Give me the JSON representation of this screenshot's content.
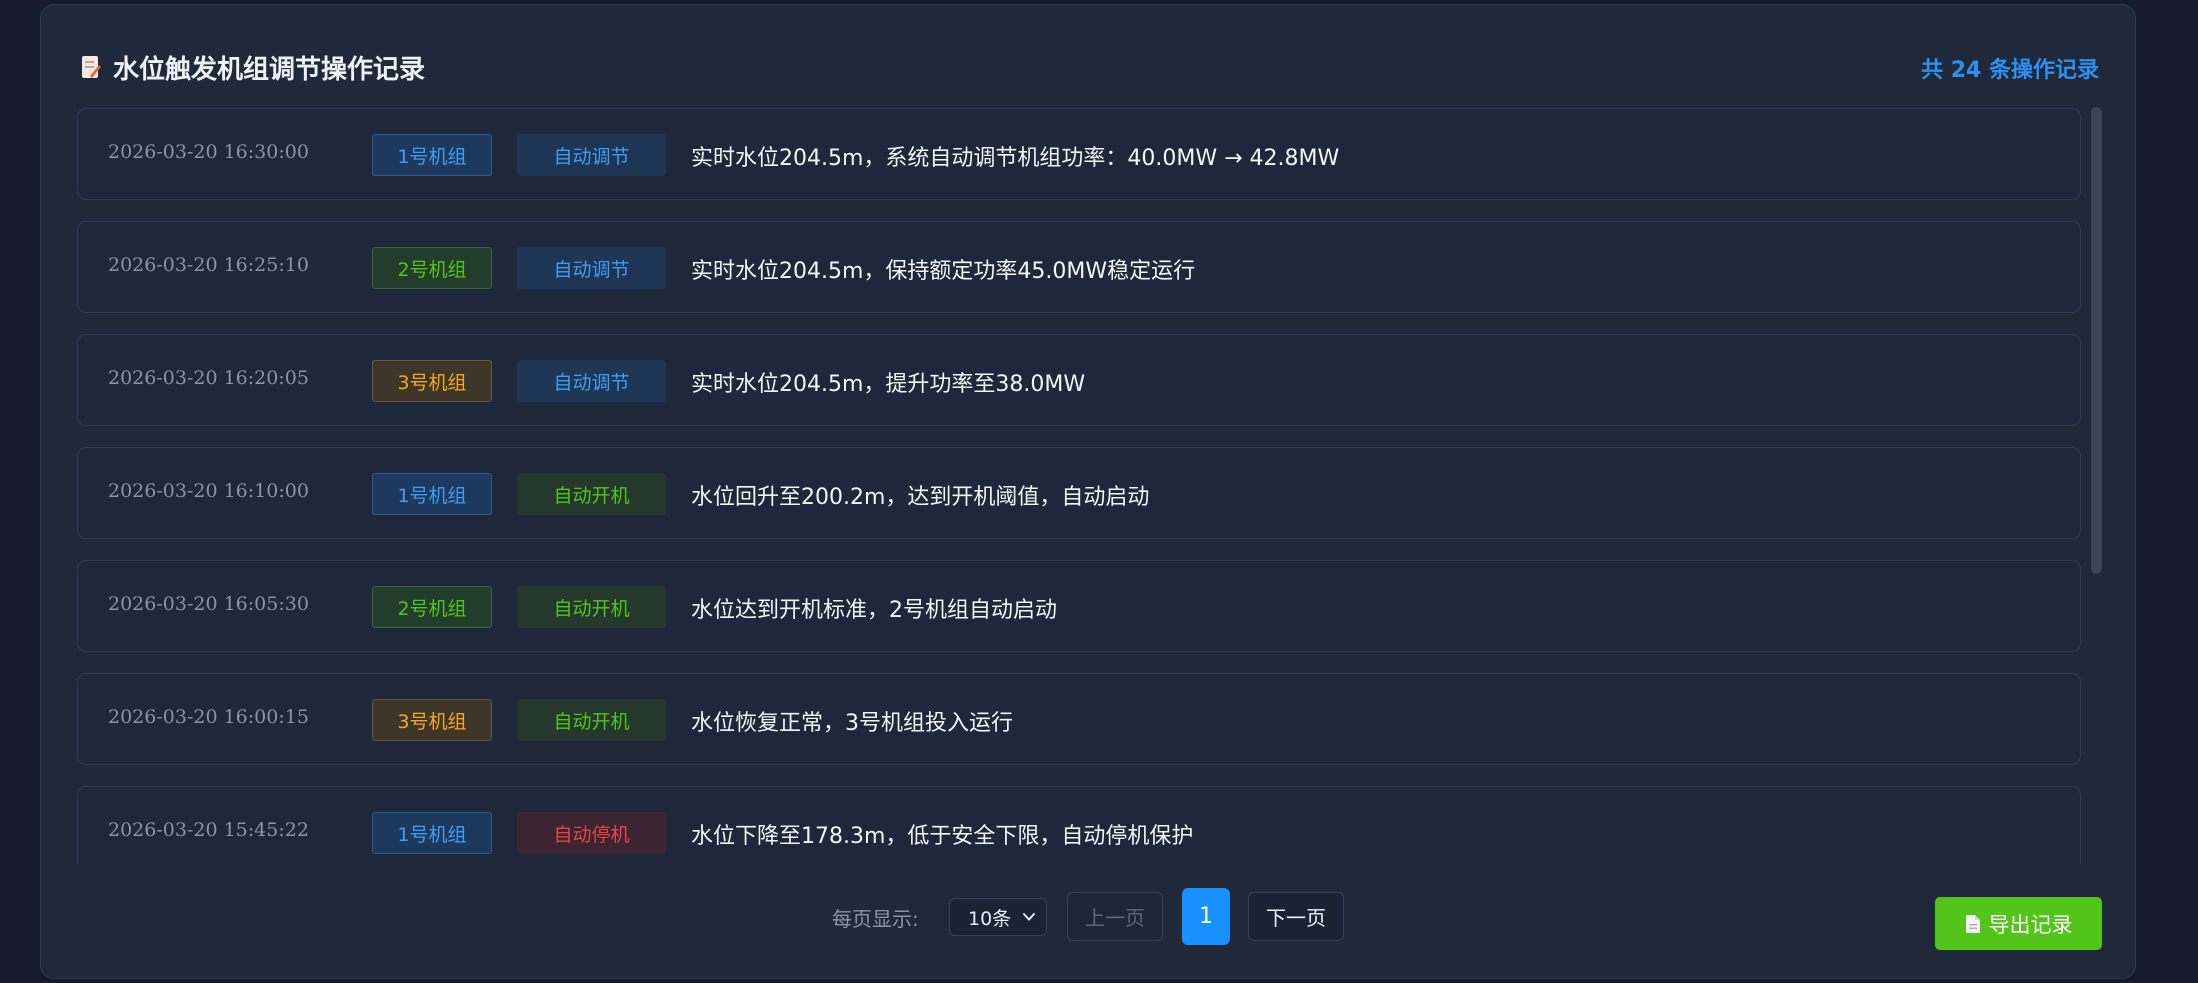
{
  "header": {
    "title": "水位触发机组调节操作记录",
    "title_icon": "memo-icon",
    "count_label": "共 24 条操作记录"
  },
  "colors": {
    "accent_blue": "#1890ff",
    "unit1": "#3f9cf2",
    "unit2": "#52c41a",
    "unit3": "#f5a623",
    "stop_red": "#e64545",
    "export_green": "#52c41a"
  },
  "records": [
    {
      "time": "2026-03-20 16:30:00",
      "unit": "1号机组",
      "action": "自动调节",
      "message": "实时水位204.5m，系统自动调节机组功率：40.0MW → 42.8MW"
    },
    {
      "time": "2026-03-20 16:25:10",
      "unit": "2号机组",
      "action": "自动调节",
      "message": "实时水位204.5m，保持额定功率45.0MW稳定运行"
    },
    {
      "time": "2026-03-20 16:20:05",
      "unit": "3号机组",
      "action": "自动调节",
      "message": "实时水位204.5m，提升功率至38.0MW"
    },
    {
      "time": "2026-03-20 16:10:00",
      "unit": "1号机组",
      "action": "自动开机",
      "message": "水位回升至200.2m，达到开机阈值，自动启动"
    },
    {
      "time": "2026-03-20 16:05:30",
      "unit": "2号机组",
      "action": "自动开机",
      "message": "水位达到开机标准，2号机组自动启动"
    },
    {
      "time": "2026-03-20 16:00:15",
      "unit": "3号机组",
      "action": "自动开机",
      "message": "水位恢复正常，3号机组投入运行"
    },
    {
      "time": "2026-03-20 15:45:22",
      "unit": "1号机组",
      "action": "自动停机",
      "message": "水位下降至178.3m，低于安全下限，自动停机保护"
    }
  ],
  "pagination": {
    "per_page_label": "每页显示:",
    "page_size": "10条",
    "prev_label": "上一页",
    "current_page": "1",
    "next_label": "下一页"
  },
  "export": {
    "label": "导出记录",
    "icon": "document-icon"
  }
}
